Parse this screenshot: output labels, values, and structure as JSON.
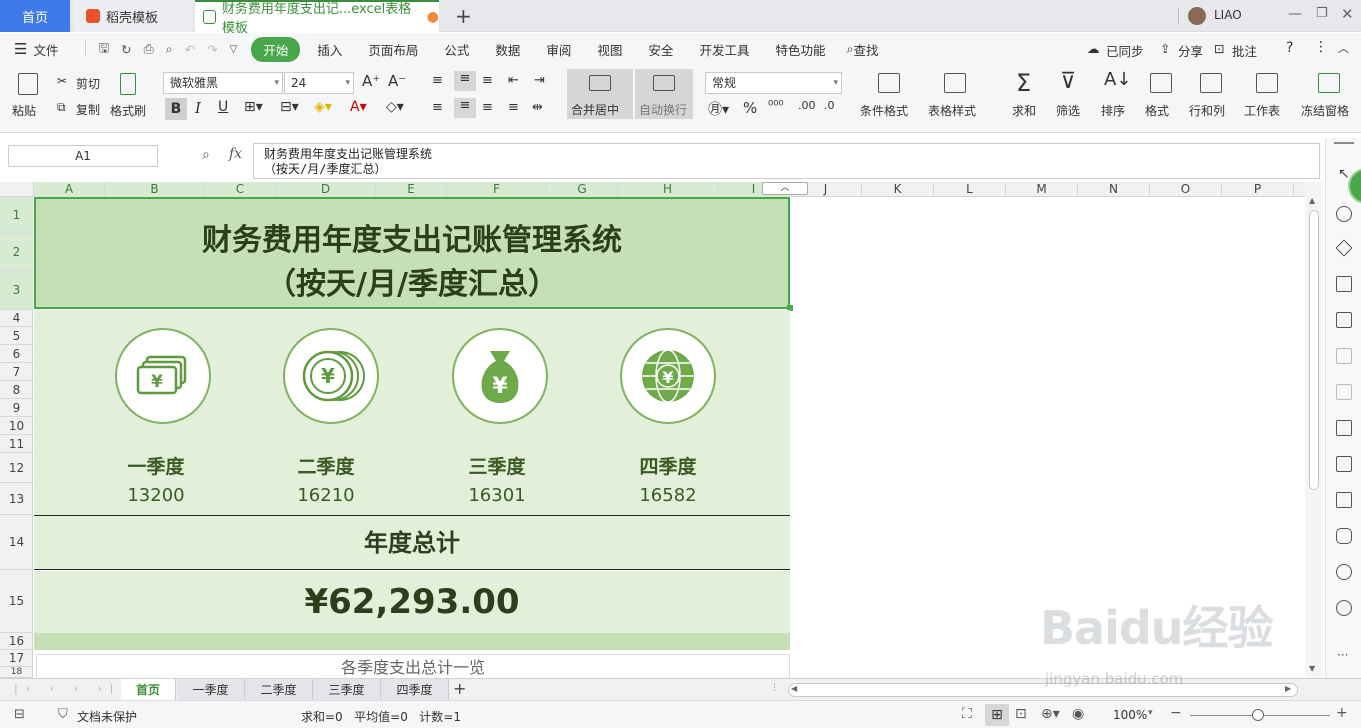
{
  "tabs": {
    "home": "首页",
    "docer": "稻壳模板",
    "file": "财务费用年度支出记...excel表格模板",
    "add": "+"
  },
  "user": {
    "name": "LIAO"
  },
  "menu": {
    "items": [
      "文件",
      "开始",
      "插入",
      "页面布局",
      "公式",
      "数据",
      "审阅",
      "视图",
      "安全",
      "开发工具",
      "特色功能"
    ],
    "search": "查找",
    "synced": "已同步",
    "share": "分享",
    "annotate": "批注"
  },
  "ribbon": {
    "paste": "粘贴",
    "cut": "剪切",
    "copy": "复制",
    "format_painter": "格式刷",
    "font": "微软雅黑",
    "size": "24",
    "merge_center": "合并居中",
    "wrap": "自动换行",
    "number_format": "常规",
    "cond_format": "条件格式",
    "table_style": "表格样式",
    "sum": "求和",
    "filter": "筛选",
    "sort": "排序",
    "format": "格式",
    "row_col": "行和列",
    "worksheet": "工作表",
    "freeze": "冻结窗格"
  },
  "formula_bar": {
    "name_box": "A1",
    "fx": "fx",
    "content": "财务费用年度支出记账管理系统\n（按天/月/季度汇总）"
  },
  "columns": [
    "A",
    "B",
    "C",
    "D",
    "E",
    "F",
    "G",
    "H",
    "I",
    "J",
    "K",
    "L",
    "M",
    "N",
    "O",
    "P"
  ],
  "rows": [
    "1",
    "2",
    "3",
    "4",
    "5",
    "6",
    "7",
    "8",
    "9",
    "10",
    "11",
    "12",
    "13",
    "14",
    "15",
    "16",
    "17",
    "18"
  ],
  "dashboard": {
    "title_line1": "财务费用年度支出记账管理系统",
    "title_line2": "（按天/月/季度汇总）",
    "quarters": [
      {
        "label": "一季度",
        "value": "13200",
        "icon": "cash-stack-icon"
      },
      {
        "label": "二季度",
        "value": "16210",
        "icon": "coin-stack-icon"
      },
      {
        "label": "三季度",
        "value": "16301",
        "icon": "money-bag-icon"
      },
      {
        "label": "四季度",
        "value": "16582",
        "icon": "globe-yen-icon"
      }
    ],
    "annual_title": "年度总计",
    "annual_total": "¥62,293.00",
    "subcaption": "各季度支出总计一览"
  },
  "sheet_tabs": [
    "首页",
    "一季度",
    "二季度",
    "三季度",
    "四季度"
  ],
  "status": {
    "protection": "文档未保护",
    "stats": "求和=0   平均值=0   计数=1",
    "zoom": "100%"
  },
  "watermark": {
    "main": "Baidu经验",
    "sub": "jingyan.baidu.com"
  },
  "colors": {
    "accent": "#4aa64a",
    "title_bg": "#c5e0b5",
    "panel_bg": "#e2efd9",
    "text_dark": "#2c3e1b"
  }
}
